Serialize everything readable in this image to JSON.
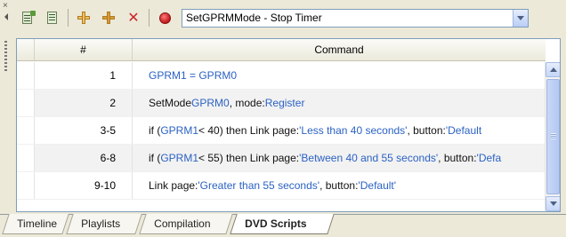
{
  "toolbar": {
    "buttons": [
      {
        "name": "add-script-icon"
      },
      {
        "name": "script-properties-icon"
      },
      {
        "name": "insert-command-icon"
      },
      {
        "name": "add-command-icon"
      },
      {
        "name": "delete-command-icon"
      },
      {
        "name": "record-icon"
      }
    ],
    "script_select_value": "SetGPRMMode - Stop Timer"
  },
  "grid": {
    "columns": [
      "#",
      "Command"
    ],
    "rows": [
      {
        "num": "1",
        "parts": [
          {
            "t": "GPRM1 = GPRM0",
            "c": "blue"
          }
        ]
      },
      {
        "num": "2",
        "parts": [
          {
            "t": "SetMode ",
            "c": "blk"
          },
          {
            "t": "GPRM0",
            "c": "blue"
          },
          {
            "t": ", mode: ",
            "c": "blk"
          },
          {
            "t": "Register",
            "c": "blue"
          }
        ]
      },
      {
        "num": "3-5",
        "parts": [
          {
            "t": "if (",
            "c": "blk"
          },
          {
            "t": "GPRM1",
            "c": "blue"
          },
          {
            "t": " < 40) then Link page: ",
            "c": "blk"
          },
          {
            "t": "'Less than 40 seconds'",
            "c": "blue"
          },
          {
            "t": ", button: ",
            "c": "blk"
          },
          {
            "t": "'Default",
            "c": "blue"
          }
        ]
      },
      {
        "num": "6-8",
        "parts": [
          {
            "t": "if (",
            "c": "blk"
          },
          {
            "t": "GPRM1",
            "c": "blue"
          },
          {
            "t": " < 55) then Link page: ",
            "c": "blk"
          },
          {
            "t": "'Between 40 and 55 seconds'",
            "c": "blue"
          },
          {
            "t": ", button: ",
            "c": "blk"
          },
          {
            "t": "'Defa",
            "c": "blue"
          }
        ]
      },
      {
        "num": "9-10",
        "parts": [
          {
            "t": "Link page: ",
            "c": "blk"
          },
          {
            "t": "'Greater than 55 seconds'",
            "c": "blue"
          },
          {
            "t": ", button: ",
            "c": "blk"
          },
          {
            "t": "'Default'",
            "c": "blue"
          }
        ]
      }
    ]
  },
  "tabs": [
    "Timeline",
    "Playlists",
    "Compilation",
    "DVD Scripts"
  ],
  "active_tab": "DVD Scripts"
}
